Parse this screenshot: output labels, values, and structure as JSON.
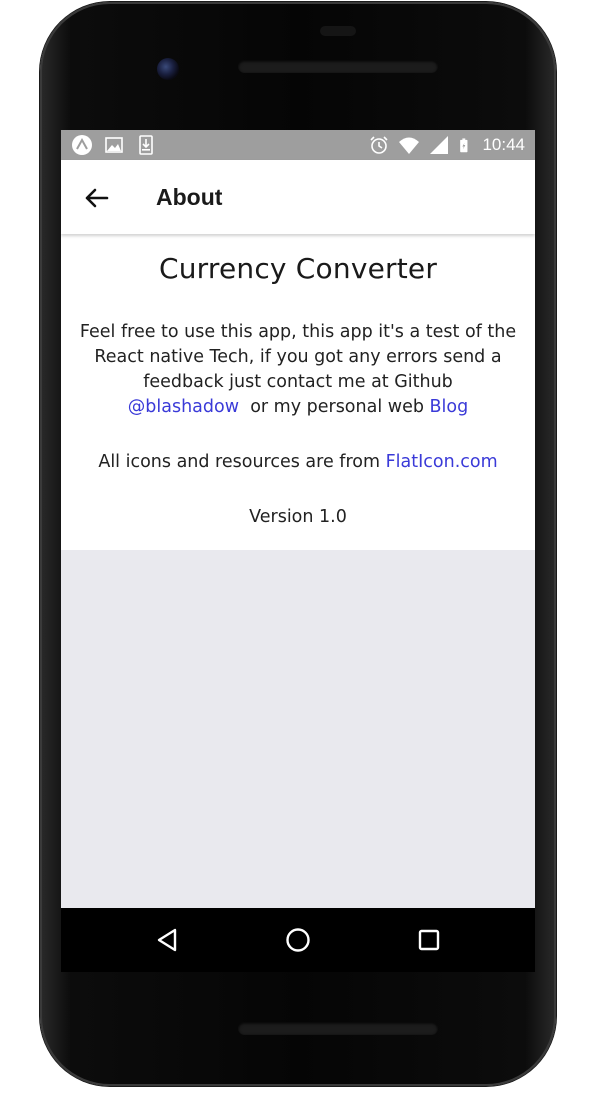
{
  "status_bar": {
    "time": "10:44",
    "left_icons": [
      "expo-icon",
      "image-icon",
      "download-icon"
    ],
    "right_icons": [
      "alarm-icon",
      "wifi-icon",
      "cell-signal-icon",
      "battery-icon"
    ]
  },
  "app_bar": {
    "title": "About",
    "back_icon": "arrow-back-icon"
  },
  "about": {
    "title": "Currency Converter",
    "description_line1": "Feel free to use this app, this app it's a test of the React native Tech, if you got any errors send a feedback just contact me at Github",
    "github_link": "@blashadow",
    "description_mid": "or my personal web",
    "blog_link": "Blog",
    "credits_prefix": "All icons and resources are from",
    "credits_link": "FlatIcon.com",
    "version": "Version 1.0"
  },
  "colors": {
    "status_bar": "#9e9e9e",
    "link": "#3a3ad8",
    "empty_background": "#e9e9ee",
    "app_bar": "#ffffff"
  },
  "nav_bar": {
    "icons": [
      "nav-back-icon",
      "nav-home-icon",
      "nav-recents-icon"
    ]
  }
}
